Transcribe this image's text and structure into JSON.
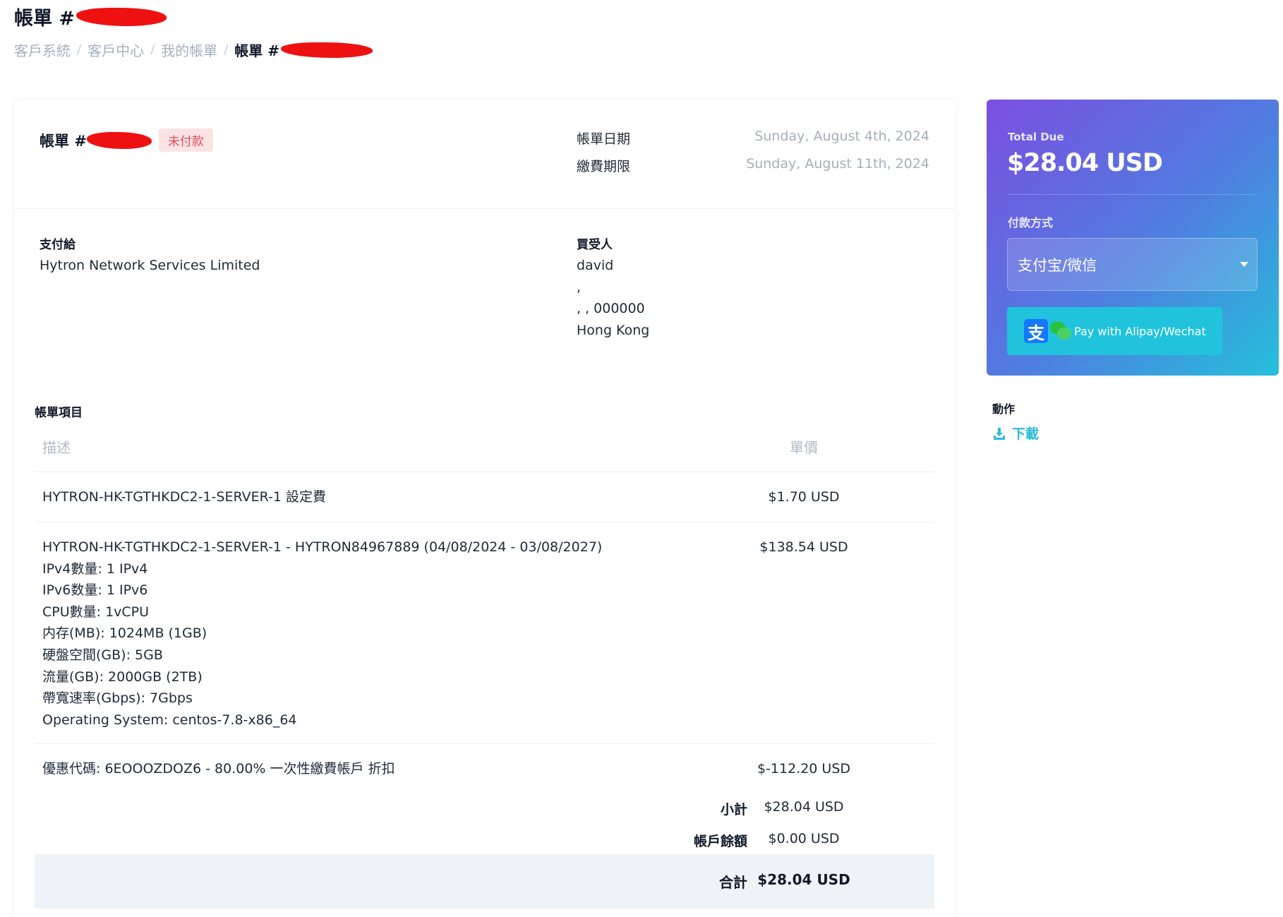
{
  "page": {
    "title": "帳單 #",
    "breadcrumb": [
      "客戶系統",
      "客戶中心",
      "我的帳單"
    ],
    "breadcrumb_current": "帳單 #",
    "breadcrumb_sep": "/"
  },
  "invoice": {
    "label": "帳單 #",
    "status": "未付款",
    "date_label": "帳單日期",
    "date_value": "Sunday, August 4th, 2024",
    "due_label": "繳費期限",
    "due_value": "Sunday, August 11th, 2024"
  },
  "pay_to": {
    "label": "支付給",
    "name": "Hytron Network Services Limited"
  },
  "buyer": {
    "label": "買受人",
    "lines": [
      "david",
      ",",
      ", , 000000",
      "Hong Kong"
    ]
  },
  "items": {
    "section_label": "帳單項目",
    "col_desc": "描述",
    "col_price": "單價",
    "rows": [
      {
        "desc": "HYTRON-HK-TGTHKDC2-1-SERVER-1 設定費",
        "price": "$1.70 USD"
      },
      {
        "desc": "HYTRON-HK-TGTHKDC2-1-SERVER-1 - HYTRON84967889 (04/08/2024 - 03/08/2027)\nIPv4數量: 1 IPv4\nIPv6数量: 1 IPv6\nCPU數量: 1vCPU\n内存(MB): 1024MB (1GB)\n硬盤空間(GB): 5GB\n流量(GB): 2000GB (2TB)\n帶寬速率(Gbps): 7Gbps\nOperating System: centos-7.8-x86_64",
        "price": "$138.54 USD"
      },
      {
        "desc": "優惠代碼: 6EOOOZDOZ6 - 80.00% 一次性繳費帳戶 折扣",
        "price": "$-112.20 USD"
      }
    ],
    "subtotal_label": "小計",
    "subtotal_value": "$28.04 USD",
    "balance_label": "帳戶餘額",
    "balance_value": "$0.00 USD",
    "total_label": "合計",
    "total_value": "$28.04 USD"
  },
  "due_panel": {
    "total_due_label": "Total Due",
    "total_due_value": "$28.04 USD",
    "method_label": "付款方式",
    "method_selected": "支付宝/微信",
    "pay_button": "Pay with Alipay/Wechat",
    "alipay_glyph": "支"
  },
  "actions": {
    "label": "動作",
    "download": "下載"
  },
  "colors": {
    "accent": "#2bbbd8",
    "unpaid_badge_bg": "#fbe3e4",
    "unpaid_badge_text": "#e0505d",
    "gradient_start": "#7b4fe0",
    "gradient_end": "#25c0da"
  }
}
